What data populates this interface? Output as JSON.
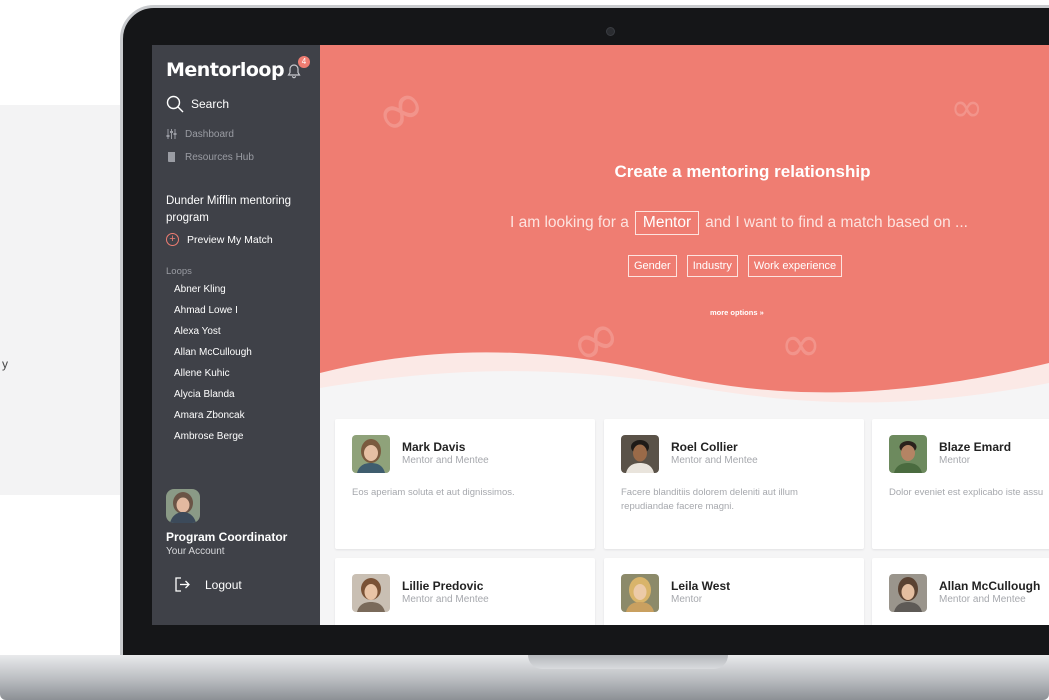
{
  "sidebar": {
    "logo": "Mentorloop",
    "notification_count": "4",
    "search_label": "Search",
    "nav": [
      {
        "label": "Dashboard",
        "icon": "sliders-icon"
      },
      {
        "label": "Resources Hub",
        "icon": "book-icon"
      }
    ],
    "program_name": "Dunder Mifflin mentoring program",
    "preview_label": "Preview My Match",
    "loops_title": "Loops",
    "loops": [
      "Abner Kling",
      "Ahmad Lowe I",
      "Alexa Yost",
      "Allan McCullough",
      "Allene Kuhic",
      "Alycia Blanda",
      "Amara Zboncak",
      "Ambrose Berge"
    ],
    "user_title": "Program Coordinator",
    "user_subtitle": "Your Account",
    "logout_label": "Logout"
  },
  "hero": {
    "title": "Create a mentoring relationship",
    "sentence_start": "I am looking for a",
    "role_choice": "Mentor",
    "sentence_end": "and I want to find a match based on ...",
    "tags": [
      "Gender",
      "Industry",
      "Work experience"
    ],
    "more_options": "more options »"
  },
  "cards": [
    {
      "name": "Mark Davis",
      "role": "Mentor and Mentee",
      "desc": "Eos aperiam soluta et aut dignissimos."
    },
    {
      "name": "Roel Collier",
      "role": "Mentor and Mentee",
      "desc": "Facere blanditiis dolorem deleniti aut illum repudiandae facere magni."
    },
    {
      "name": "Blaze Emard",
      "role": "Mentor",
      "desc": "Dolor eveniet est explicabo iste assu"
    },
    {
      "name": "Lillie Predovic",
      "role": "Mentor and Mentee",
      "desc": ""
    },
    {
      "name": "Leila West",
      "role": "Mentor",
      "desc": ""
    },
    {
      "name": "Allan McCullough",
      "role": "Mentor and Mentee",
      "desc": ""
    }
  ],
  "colors": {
    "accent": "#ef7d72",
    "sidebar": "#3f4148",
    "muted_text": "#a6a8ad"
  }
}
